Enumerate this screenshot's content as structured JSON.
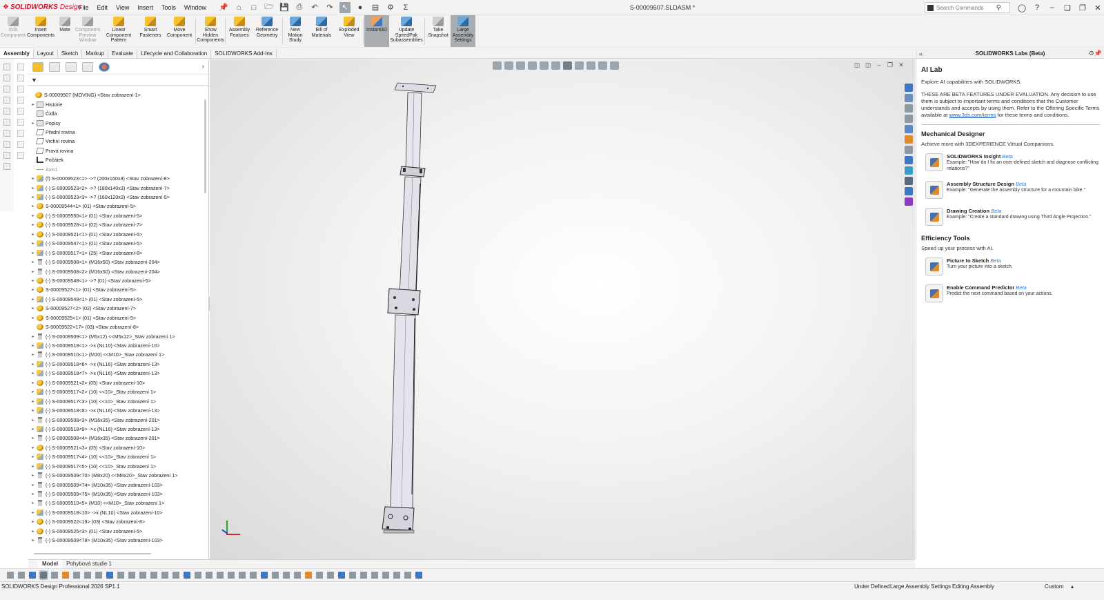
{
  "app": {
    "logo_brand": "SOLIDWORKS",
    "logo_suffix": "Design",
    "doc_title": "S-00009507.SLDASM *",
    "menus": [
      "File",
      "Edit",
      "View",
      "Insert",
      "Tools",
      "Window"
    ],
    "search_placeholder": "Search Commands"
  },
  "ribbon": [
    {
      "label": "Edit Component",
      "disabled": true,
      "icon": "edit-component-icon"
    },
    {
      "label": "Insert Components",
      "icon": "insert-components-icon"
    },
    {
      "label": "Mate",
      "icon": "mate-icon"
    },
    {
      "label": "Component Preview Window",
      "disabled": true,
      "icon": "component-preview-icon"
    },
    {
      "label": "Linear Component Pattern",
      "icon": "linear-pattern-icon"
    },
    {
      "label": "Smart Fasteners",
      "icon": "smart-fasteners-icon"
    },
    {
      "label": "Move Component",
      "icon": "move-component-icon"
    },
    {
      "label": "Show Hidden Components",
      "icon": "show-hidden-icon"
    },
    {
      "label": "Assembly Features",
      "icon": "assembly-features-icon"
    },
    {
      "label": "Reference Geometry",
      "icon": "reference-geometry-icon"
    },
    {
      "label": "New Motion Study",
      "icon": "motion-study-icon"
    },
    {
      "label": "Bill of Materials",
      "icon": "bill-of-materials-icon"
    },
    {
      "label": "Exploded View",
      "icon": "exploded-view-icon"
    },
    {
      "label": "Instant3D",
      "active": true,
      "icon": "instant3d-icon"
    },
    {
      "label": "Update SpeedPak Subassemblies",
      "icon": "speedpak-icon"
    },
    {
      "label": "Take Snapshot",
      "icon": "snapshot-icon"
    },
    {
      "label": "Large Assembly Settings",
      "active": true,
      "icon": "large-assembly-icon"
    }
  ],
  "tabs": [
    "Assembly",
    "Layout",
    "Sketch",
    "Markup",
    "Evaluate",
    "Lifecycle and Collaboration",
    "SOLIDWORKS Add-Ins"
  ],
  "active_tab": "Assembly",
  "tree": {
    "root": "S-00009507 (MOVING) <Stav zobrazení-1>",
    "nodes": [
      {
        "label": "Historie",
        "icon": "history-folder-icon",
        "expand": true
      },
      {
        "label": "Čidla",
        "icon": "sensors-folder-icon",
        "expand": false
      },
      {
        "label": "Popisy",
        "icon": "annotations-folder-icon",
        "expand": true
      },
      {
        "label": "Přední rovina",
        "icon": "plane-icon",
        "expand": false
      },
      {
        "label": "Vrchní rovina",
        "icon": "plane-icon",
        "expand": false
      },
      {
        "label": "Pravá rovina",
        "icon": "plane-icon",
        "expand": false
      },
      {
        "label": "Počátek",
        "icon": "origin-icon",
        "expand": false
      },
      {
        "label": "Axis1",
        "icon": "axis-icon",
        "expand": false
      },
      {
        "label": "(f) S-00009523<1> ->? (200x160x3) <Stav zobrazení-8>",
        "icon": "part-icon",
        "expand": true
      },
      {
        "label": "(-) S-00009523<2> ->? (180x140x3) <Stav zobrazení-7>",
        "icon": "part-icon",
        "expand": true
      },
      {
        "label": "(-) S-00009523<3> ->? (160x120x3) <Stav zobrazení-5>",
        "icon": "part-icon",
        "expand": true
      },
      {
        "label": "S-00009544<1> (01) <Stav zobrazení-5>",
        "icon": "subassembly-icon",
        "expand": true
      },
      {
        "label": "(-) S-00009550<1> (01) <Stav zobrazení-5>",
        "icon": "subassembly-icon",
        "expand": true
      },
      {
        "label": "(-) S-00009528<1> (02) <Stav zobrazení-7>",
        "icon": "subassembly-icon",
        "expand": true
      },
      {
        "label": "(-) S-00009521<1> (01) <Stav zobrazení-5>",
        "icon": "subassembly-icon",
        "expand": true
      },
      {
        "label": "(-) S-00009547<1> (01) <Stav zobrazení-5>",
        "icon": "part-icon",
        "expand": true
      },
      {
        "label": "(-) S-00009517<1> (25) <Stav zobrazení-8>",
        "icon": "part-icon",
        "expand": true
      },
      {
        "label": "(-) S-00009508<1> (M16x50) <Stav zobrazení-204>",
        "icon": "bolt-icon",
        "expand": true
      },
      {
        "label": "(-) S-00009508<2> (M16x50) <Stav zobrazení-204>",
        "icon": "bolt-icon",
        "expand": true
      },
      {
        "label": "(-) S-00009548<1> ->? (01) <Stav zobrazení-5>",
        "icon": "subassembly-icon",
        "expand": true
      },
      {
        "label": "S-00009527<1> (01) <Stav zobrazení-5>",
        "icon": "subassembly-icon",
        "expand": true
      },
      {
        "label": "(-) S-00009549<1> (01) <Stav zobrazení-5>",
        "icon": "part-icon",
        "expand": true
      },
      {
        "label": "S-00009527<2> (02) <Stav zobrazení-7>",
        "icon": "subassembly-icon",
        "expand": true
      },
      {
        "label": "S-00009525<1> (01) <Stav zobrazení-5>",
        "icon": "subassembly-icon",
        "expand": true
      },
      {
        "label": "S-00009522<17> (03) <Stav zobrazení-8>",
        "icon": "subassembly-icon",
        "expand": false
      },
      {
        "label": "(-) S-00009509<1> (M5x12) <<M5x12>_Stav zobrazení 1>",
        "icon": "bolt-icon",
        "expand": true
      },
      {
        "label": "(-) S-00009518<1> ->x (NL10) <Stav zobrazení-10>",
        "icon": "part-icon",
        "expand": true
      },
      {
        "label": "(-) S-00009510<1> (M10) <<M10>_Stav zobrazení 1>",
        "icon": "bolt-icon",
        "expand": true
      },
      {
        "label": "(-) S-00009518<6> ->x (NL16) <Stav zobrazení-13>",
        "icon": "part-icon",
        "expand": true
      },
      {
        "label": "(-) S-00009518<7> ->x (NL16) <Stav zobrazení-13>",
        "icon": "part-icon",
        "expand": true
      },
      {
        "label": "(-) S-00009521<2> (05) <Stav zobrazení-10>",
        "icon": "subassembly-icon",
        "expand": true
      },
      {
        "label": "(-) S-00009517<2> (10) <<10>_Stav zobrazení 1>",
        "icon": "part-icon",
        "expand": true
      },
      {
        "label": "(-) S-00009517<3> (10) <<10>_Stav zobrazení 1>",
        "icon": "part-icon",
        "expand": true
      },
      {
        "label": "(-) S-00009518<8> ->x (NL16) <Stav zobrazení-13>",
        "icon": "part-icon",
        "expand": true
      },
      {
        "label": "(-) S-00009508<3> (M16x35) <Stav zobrazení-201>",
        "icon": "bolt-icon",
        "expand": true
      },
      {
        "label": "(-) S-00009518<9> ->x (NL16) <Stav zobrazení-13>",
        "icon": "part-icon",
        "expand": true
      },
      {
        "label": "(-) S-00009508<4> (M16x35) <Stav zobrazení-201>",
        "icon": "bolt-icon",
        "expand": true
      },
      {
        "label": "(-) S-00009521<3> (05) <Stav zobrazení-10>",
        "icon": "subassembly-icon",
        "expand": true
      },
      {
        "label": "(-) S-00009517<4> (10) <<10>_Stav zobrazení 1>",
        "icon": "part-icon",
        "expand": true
      },
      {
        "label": "(-) S-00009517<5> (10) <<10>_Stav zobrazení 1>",
        "icon": "part-icon",
        "expand": true
      },
      {
        "label": "(-) S-00009509<70> (M8x20) <<M8x20>_Stav zobrazení 1>",
        "icon": "bolt-icon",
        "expand": true
      },
      {
        "label": "(-) S-00009509<74> (M10x35) <Stav zobrazení-103>",
        "icon": "bolt-icon",
        "expand": true
      },
      {
        "label": "(-) S-00009509<75> (M10x35) <Stav zobrazení-103>",
        "icon": "bolt-icon",
        "expand": true
      },
      {
        "label": "(-) S-00009510<5> (M10) <<M10>_Stav zobrazení 1>",
        "icon": "bolt-icon",
        "expand": true
      },
      {
        "label": "(-) S-00009518<10> ->x (NL10) <Stav zobrazení-10>",
        "icon": "part-icon",
        "expand": true
      },
      {
        "label": "(-) S-00009522<19> (03) <Stav zobrazení-8>",
        "icon": "subassembly-icon",
        "expand": true
      },
      {
        "label": "(-) S-00009525<3> (01) <Stav zobrazení-5>",
        "icon": "subassembly-icon",
        "expand": true
      },
      {
        "label": "(-) S-00009509<78> (M10x35) <Stav zobrazení-103>",
        "icon": "bolt-icon",
        "expand": true
      }
    ]
  },
  "bottom_tabs": [
    "Model",
    "Pohybová studie 1"
  ],
  "right_panel": {
    "title": "SOLIDWORKS Labs (Beta)",
    "ai_lab_title": "AI Lab",
    "ai_lab_sub": "Explore AI capabilities with SOLIDWORKS.",
    "disclaimer_pre": "THESE ARE BETA FEATURES UNDER EVALUATION. Any decision to use them is subject to important terms and conditions that the Customer understands and accepts by using them. Refer to the Offering Specific Terms available at ",
    "disclaimer_link": "www.3ds.com/terms",
    "disclaimer_post": " for these terms and conditions.",
    "mech_title": "Mechanical Designer",
    "mech_sub": "Achieve more with 3DEXPERIENCE Virtual Companions.",
    "mech_cards": [
      {
        "title": "SOLIDWORKS Insight",
        "badge": "Beta",
        "desc": "Example: \"How do I fix an over-defined sketch and diagnose conflicting relations?\""
      },
      {
        "title": "Assembly Structure Design",
        "badge": "Beta",
        "desc": "Example: \"Generate the assembly structure for a mountain bike.\""
      },
      {
        "title": "Drawing Creation",
        "badge": "Beta",
        "desc": "Example: \"Create a standard drawing using Third Angle Projection.\""
      }
    ],
    "eff_title": "Efficiency Tools",
    "eff_sub": "Speed up your process with AI.",
    "eff_cards": [
      {
        "title": "Picture to Sketch",
        "badge": "Beta",
        "desc": "Turn your picture into a sketch."
      },
      {
        "title": "Enable Command Predictor",
        "badge": "Beta",
        "desc": "Predict the next command based on your actions."
      }
    ]
  },
  "status": {
    "product": "SOLIDWORKS Design Professional 2026 SP1.1",
    "definition": "Under Defined",
    "large_assembly": "Large Assembly Settings",
    "mode": "Editing Assembly",
    "units": "Custom"
  }
}
